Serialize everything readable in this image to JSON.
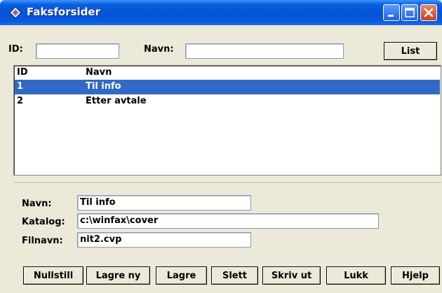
{
  "window": {
    "title": "Faksforsider"
  },
  "search": {
    "id_label": "ID:",
    "id_value": "",
    "navn_label": "Navn:",
    "navn_value": "",
    "list_button": "List"
  },
  "list": {
    "columns": [
      "ID",
      "Navn"
    ],
    "rows": [
      {
        "id": "1",
        "navn": "Til info",
        "selected": true
      },
      {
        "id": "2",
        "navn": "Etter avtale",
        "selected": false
      }
    ]
  },
  "details": {
    "navn_label": "Navn:",
    "navn_value": "Til info",
    "katalog_label": "Katalog:",
    "katalog_value": "c:\\winfax\\cover",
    "filnavn_label": "Filnavn:",
    "filnavn_value": "nit2.cvp"
  },
  "buttons": {
    "nullstill": "Nullstill",
    "lagre_ny": "Lagre ny",
    "lagre": "Lagre",
    "slett": "Slett",
    "skriv_ut": "Skriv ut",
    "lukk": "Lukk",
    "hjelp": "Hjelp"
  },
  "colors": {
    "titlebar": "#0553d6",
    "selection": "#316ac5",
    "face": "#ece9d8"
  }
}
